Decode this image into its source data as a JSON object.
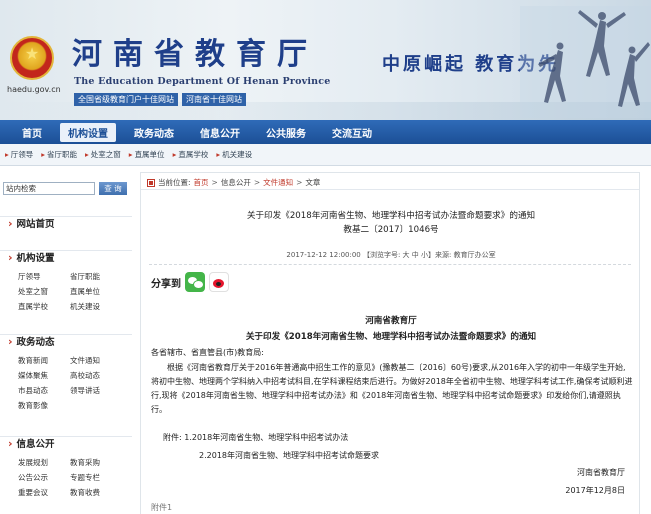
{
  "header": {
    "emblem_url": "haedu.gov.cn",
    "title": "河南省教育厅",
    "subtitle_en": "The Education Department Of Henan Province",
    "site_links": [
      "全国省级教育门户十佳网站",
      "河南省十佳网站"
    ],
    "slogan": "中原崛起  教育为先"
  },
  "nav": {
    "items": [
      "首页",
      "机构设置",
      "政务动态",
      "信息公开",
      "公共服务",
      "交流互动"
    ],
    "active_index": 1
  },
  "subnav": {
    "items": [
      "厅领导",
      "省厅职能",
      "处室之窗",
      "直属单位",
      "直属学校",
      "机关建设"
    ]
  },
  "sidebar": {
    "search_placeholder": "站内检索",
    "search_button": "查 询",
    "sections": [
      {
        "title": "网站首页",
        "links": []
      },
      {
        "title": "机构设置",
        "links": [
          "厅领导",
          "省厅职能",
          "处室之窗",
          "直属单位",
          "直属学校",
          "机关建设"
        ]
      },
      {
        "title": "政务动态",
        "links": [
          "教育新闻",
          "文件通知",
          "媒体聚焦",
          "高校动态",
          "市县动态",
          "领导讲话",
          "教育影像"
        ]
      },
      {
        "title": "信息公开",
        "links": [
          "发展规划",
          "教育采购",
          "公告公示",
          "专题专栏",
          "重要会议",
          "教育收费"
        ]
      }
    ]
  },
  "breadcrumb": {
    "label": "当前位置:",
    "items": [
      "首页",
      "信息公开",
      "文件通知",
      "文章"
    ],
    "sep": ">"
  },
  "article": {
    "title_line1": "关于印发《2018年河南省生物、地理学科中招考试办法暨命题要求》的通知",
    "title_line2": "教基二〔2017〕1046号",
    "meta": "2017-12-12 12:00:00 【浏览字号: 大 中 小】来源: 教育厅办公室",
    "share_label": "分享到",
    "issuer": "河南省教育厅",
    "heading": "关于印发《2018年河南省生物、地理学科中招考试办法暨命题要求》的通知",
    "recipient": "各省辖市、省直管县(市)教育局:",
    "paragraph": "根据《河南省教育厅关于2016年普通高中招生工作的意见》(豫教基二〔2016〕60号)要求,从2016年入学的初中一年级学生开始,将初中生物、地理两个学科纳入中招考试科目,在学科课程结束后进行。为做好2018年全省初中生物、地理学科考试工作,确保考试顺利进行,现将《2018年河南省生物、地理学科中招考试办法》和《2018年河南省生物、地理学科中招考试命题要求》印发给你们,请遵照执行。",
    "attachment1": "附件: 1.2018年河南省生物、地理学科中招考试办法",
    "attachment2": "2.2018年河南省生物、地理学科中招考试命题要求",
    "signature": "河南省教育厅",
    "date": "2017年12月8日",
    "footer_text": "附件1"
  },
  "colors": {
    "brand_blue": "#1f3f8a",
    "nav_blue": "#1c4f96",
    "accent_red": "#c0392b"
  }
}
